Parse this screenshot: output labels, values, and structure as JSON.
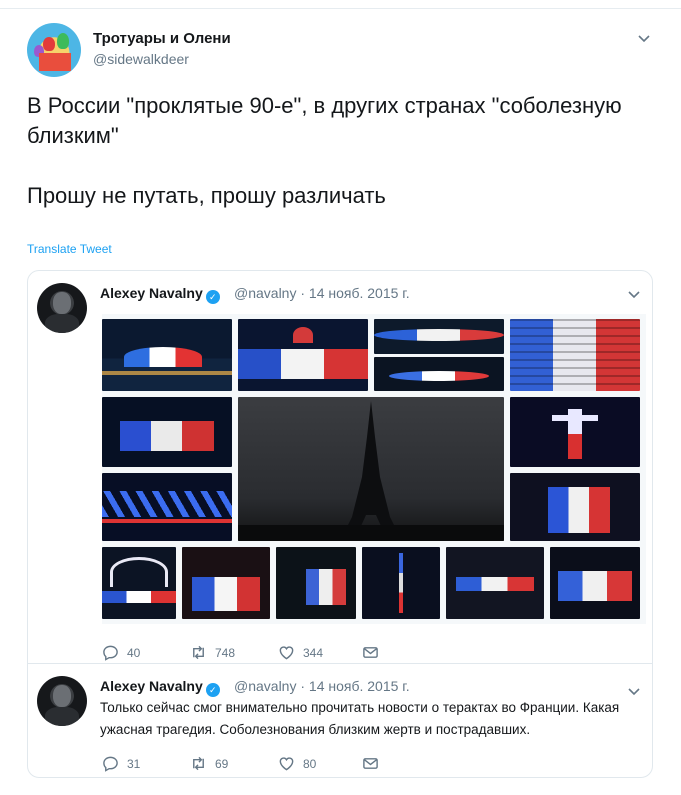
{
  "tweet": {
    "author_name": "Тротуары и Олени",
    "author_handle": "@sidewalkdeer",
    "avatar_icon": "moscow-cathedral-icon",
    "text": "В России \"проклятые 90-е\", в других странах \"соболезную близким\"\n\nПрошу не путать, прошу различать",
    "translate_label": "Translate Tweet",
    "accent_color": "#1da1f2"
  },
  "quote1": {
    "author_name": "Alexey Navalny",
    "verified_icon": "verified-badge-icon",
    "meta": "@navalny · 14 нояб. 2015 г.",
    "photo_tiles": [
      "sydney-opera-house-photo",
      "san-francisco-city-hall-photo",
      "stadium-lights-photo",
      "tower-building-flag-colors-photo",
      "lit-building-photo",
      "eiffel-tower-dark-photo",
      "christ-redeemer-statue-photo",
      "lit-bridge-photo",
      "lit-city-hall-photo",
      "wembley-stadium-photo",
      "arena-flag-photo",
      "lit-skyline-photo",
      "sky-tower-photo",
      "toronto-sign-photo",
      "lit-palace-photo"
    ],
    "counts": {
      "replies": "40",
      "retweets": "748",
      "likes": "344"
    }
  },
  "quote2": {
    "author_name": "Alexey Navalny",
    "meta": "@navalny · 14 нояб. 2015 г.",
    "text": "Только сейчас смог внимательно прочитать новости о терактах во Франции. Какая ужасная трагедия. Соболезнования близким жертв и пострадавших.",
    "counts": {
      "replies": "31",
      "retweets": "69",
      "likes": "80"
    }
  }
}
